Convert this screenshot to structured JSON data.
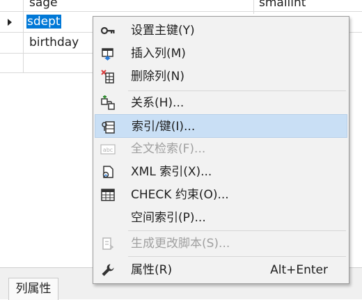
{
  "grid": {
    "rows": [
      {
        "name": "sage",
        "type": "smallint"
      },
      {
        "name": "sdept",
        "type": ""
      },
      {
        "name": "birthday",
        "type": ""
      }
    ]
  },
  "bottom": {
    "tab_label": "列属性"
  },
  "menu": {
    "items": [
      {
        "label": "设置主键(Y)",
        "icon": "key-icon",
        "enabled": true
      },
      {
        "label": "插入列(M)",
        "icon": "insert-column-icon",
        "enabled": true
      },
      {
        "label": "删除列(N)",
        "icon": "delete-column-icon",
        "enabled": true
      },
      {
        "label": "关系(H)...",
        "icon": "relationship-icon",
        "enabled": true
      },
      {
        "label": "索引/键(I)...",
        "icon": "index-key-icon",
        "enabled": true,
        "highlighted": true
      },
      {
        "label": "全文检索(F)...",
        "icon": "fulltext-icon",
        "enabled": false
      },
      {
        "label": "XML 索引(X)...",
        "icon": "xml-index-icon",
        "enabled": true
      },
      {
        "label": "CHECK 约束(O)...",
        "icon": "check-constraint-icon",
        "enabled": true
      },
      {
        "label": "空间索引(P)...",
        "icon": "",
        "enabled": true
      },
      {
        "label": "生成更改脚本(S)...",
        "icon": "generate-script-icon",
        "enabled": false
      },
      {
        "label": "属性(R)",
        "shortcut": "Alt+Enter",
        "icon": "wrench-icon",
        "enabled": true
      }
    ]
  },
  "colors": {
    "selection": "#0078d7",
    "highlight": "#c9dff5",
    "disabled_text": "#a0a0a0"
  }
}
